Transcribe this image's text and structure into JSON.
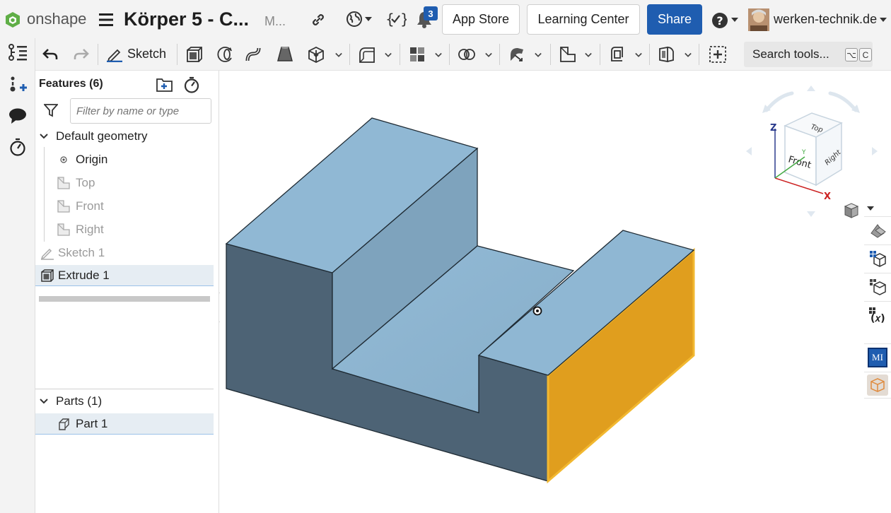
{
  "topbar": {
    "logo_text": "onshape",
    "doc_title": "Körper 5 - C...",
    "doc_subtitle": "M...",
    "notification_count": "3",
    "app_store": "App Store",
    "learning_center": "Learning Center",
    "share": "Share",
    "user_name": "werken-technik.de",
    "accent_color": "#1f5db0"
  },
  "toolbar": {
    "sketch_label": "Sketch",
    "search_label": "Search tools...",
    "search_shortcut_1": "⌥",
    "search_shortcut_2": "C"
  },
  "features": {
    "header": "Features (6)",
    "filter_placeholder": "Filter by name or type",
    "default_geometry": "Default geometry",
    "items": [
      {
        "label": "Origin"
      },
      {
        "label": "Top"
      },
      {
        "label": "Front"
      },
      {
        "label": "Right"
      },
      {
        "label": "Sketch 1"
      },
      {
        "label": "Extrude 1"
      }
    ]
  },
  "parts": {
    "header": "Parts (1)",
    "items": [
      {
        "label": "Part 1"
      }
    ]
  },
  "viewcube": {
    "top": "Top",
    "front": "Front",
    "right": "Right",
    "axis_z": "Z",
    "axis_x": "X",
    "axis_y": "Y"
  },
  "colors": {
    "model_face_light": "#8fb7d3",
    "model_face_dark": "#4d6375",
    "selected_face": "#e09e1e"
  }
}
